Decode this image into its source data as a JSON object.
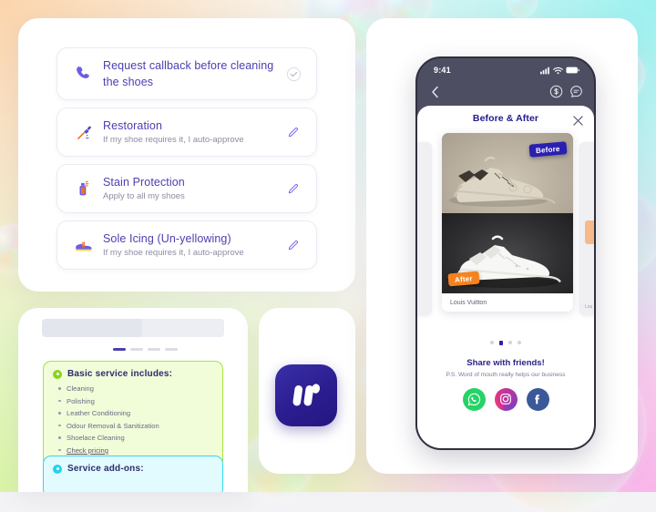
{
  "background": {
    "corner_colors": {
      "top_left": "#fbd5ab",
      "top_right": "#9cf1f0",
      "bottom_left": "#d9f4a8",
      "bottom_right": "#f9b5ea"
    }
  },
  "preferences": {
    "rows": [
      {
        "icon": "telephone-emoji",
        "title": "Request callback before cleaning the shoes",
        "subtitle": "",
        "action": "check-circle-icon"
      },
      {
        "icon": "paintbrush-emoji",
        "title": "Restoration",
        "subtitle": "If my shoe requires it, I auto-approve",
        "action": "pencil-edit-icon"
      },
      {
        "icon": "spray-bottle-emoji",
        "title": "Stain Protection",
        "subtitle": "Apply to all my shoes",
        "action": "pencil-edit-icon"
      },
      {
        "icon": "sneaker-emoji",
        "title": "Sole Icing (Un-yellowing)",
        "subtitle": "If my shoe requires it, I auto-approve",
        "action": "pencil-edit-icon"
      }
    ]
  },
  "service_card": {
    "steps": {
      "total": 4,
      "active": 1
    },
    "basic": {
      "title": "Basic service includes:",
      "accent": "#a8e53d",
      "items": [
        "Cleaning",
        "Polishing",
        "Leather Conditioning",
        "Odour Removal & Sanitization",
        "Shoelace Cleaning",
        "Check pricing"
      ],
      "link_item": "Check pricing"
    },
    "addons": {
      "title": "Service add-ons:",
      "accent": "#35d6ef"
    }
  },
  "logo": {
    "name": "brand-logo",
    "background": "#2b1d8f",
    "mark": "W"
  },
  "phone": {
    "status_bar": {
      "time": "9:41",
      "icons": [
        "cellular-signal-icon",
        "wifi-icon",
        "battery-icon"
      ]
    },
    "nav": {
      "back": "back-chevron-icon",
      "actions": [
        "dollar-circle-icon",
        "chat-bubble-icon"
      ]
    },
    "sheet": {
      "title": "Before & After",
      "close": "close-icon",
      "card": {
        "before_badge": "Before",
        "after_badge": "After",
        "brand": "Louis Vuitton"
      },
      "pagination": {
        "total": 4,
        "active": 2
      },
      "share": {
        "title": "Share with friends!",
        "subtitle": "P.S. Word of mouth really helps our business",
        "networks": [
          {
            "name": "whatsapp",
            "label": "WhatsApp"
          },
          {
            "name": "instagram",
            "label": "Instagram"
          },
          {
            "name": "facebook",
            "label": "Facebook"
          }
        ]
      }
    }
  }
}
